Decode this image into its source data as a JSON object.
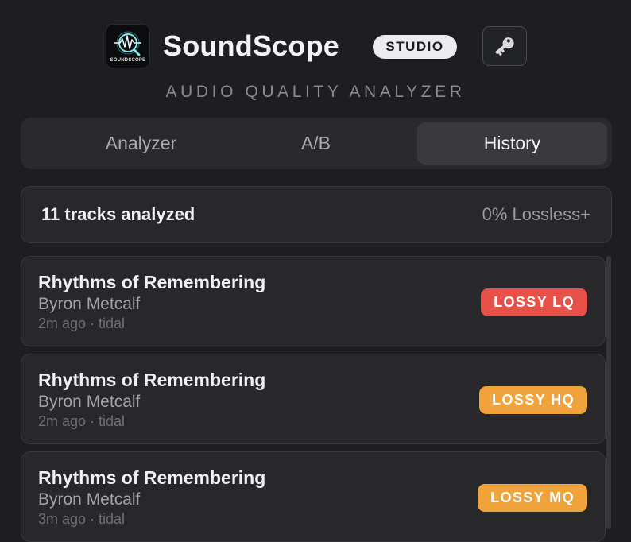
{
  "app": {
    "logo_text": "SOUNDSCOPE",
    "name": "SoundScope",
    "badge": "STUDIO",
    "subtitle": "AUDIO QUALITY ANALYZER",
    "icons": {
      "logo": "waveform-magnifier-logo",
      "key": "key-icon"
    }
  },
  "tabs": [
    {
      "label": "Analyzer",
      "active": false
    },
    {
      "label": "A/B",
      "active": false
    },
    {
      "label": "History",
      "active": true
    }
  ],
  "summary": {
    "count": "11 tracks analyzed",
    "rate": "0% Lossless+"
  },
  "tracks": [
    {
      "title": "Rhythms of Remembering",
      "artist": "Byron Metcalf",
      "meta": "2m ago · tidal",
      "quality": "LOSSY LQ",
      "color": "#e8504a"
    },
    {
      "title": "Rhythms of Remembering",
      "artist": "Byron Metcalf",
      "meta": "2m ago · tidal",
      "quality": "LOSSY HQ",
      "color": "#f0a33a"
    },
    {
      "title": "Rhythms of Remembering",
      "artist": "Byron Metcalf",
      "meta": "3m ago · tidal",
      "quality": "LOSSY MQ",
      "color": "#f0a33a"
    }
  ],
  "colors": {
    "background": "#1e1e20",
    "panel": "#28282b",
    "lossy_lq": "#e8504a",
    "lossy_hq_mq": "#f0a33a"
  }
}
